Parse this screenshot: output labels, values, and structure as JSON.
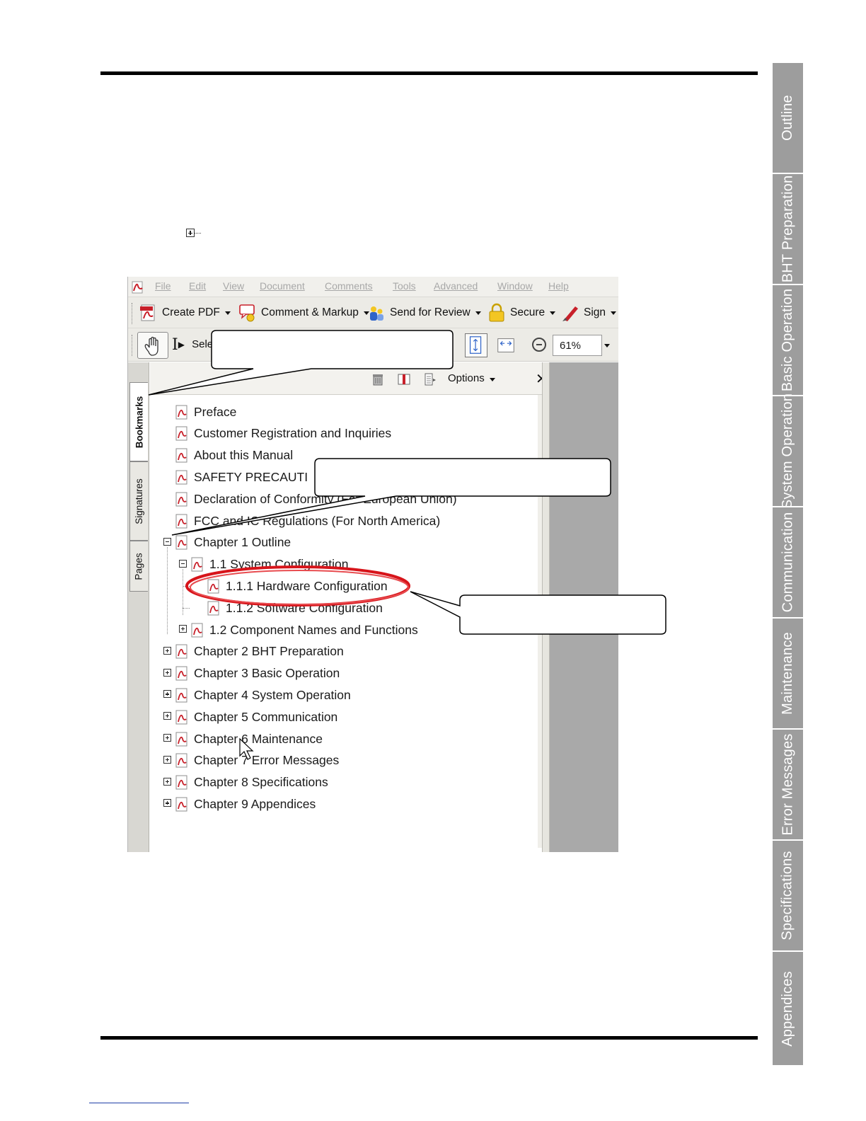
{
  "side_tabs": [
    {
      "label": "Outline",
      "active": false
    },
    {
      "label": "BHT Preparation",
      "active": false
    },
    {
      "label": "Basic Operation",
      "active": false
    },
    {
      "label": "System Operation",
      "active": false
    },
    {
      "label": "Communication",
      "active": false
    },
    {
      "label": "Maintenance",
      "active": false
    },
    {
      "label": "Error Messages",
      "active": false
    },
    {
      "label": "Specifications",
      "active": false
    },
    {
      "label": "Appendices",
      "active": false
    }
  ],
  "reader": {
    "menu": [
      "File",
      "Edit",
      "View",
      "Document",
      "Comments",
      "Tools",
      "Advanced",
      "Window",
      "Help"
    ],
    "toolbar1": {
      "create_pdf": "Create PDF",
      "comment_markup": "Comment & Markup",
      "send_for_review": "Send for Review",
      "secure": "Secure",
      "sign": "Sign"
    },
    "toolbar2": {
      "select": "Sele",
      "zoom": "61%"
    },
    "side_panel_tabs": [
      "Bookmarks",
      "Signatures",
      "Pages"
    ],
    "panel_options": "Options",
    "panel_close": "✕",
    "bookmarks": [
      {
        "label": "Preface",
        "toggle": ""
      },
      {
        "label": "Customer Registration and Inquiries",
        "toggle": ""
      },
      {
        "label": "About this Manual",
        "toggle": ""
      },
      {
        "label": "SAFETY PRECAUTI",
        "toggle": ""
      },
      {
        "label": "Declaration of Conformity (For European Union)",
        "toggle": ""
      },
      {
        "label": "FCC and IC Regulations (For North America)",
        "toggle": ""
      },
      {
        "label": "Chapter 1 Outline",
        "toggle": "minus"
      },
      {
        "label": "1.1 System Configuration",
        "toggle": "minus"
      },
      {
        "label": "1.1.1 Hardware Configuration",
        "toggle": ""
      },
      {
        "label": "1.1.2 Software Configuration",
        "toggle": ""
      },
      {
        "label": "1.2 Component Names and Functions",
        "toggle": "plus"
      },
      {
        "label": "Chapter 2 BHT Preparation",
        "toggle": "plus"
      },
      {
        "label": "Chapter 3 Basic Operation",
        "toggle": "plus"
      },
      {
        "label": "Chapter 4 System Operation",
        "toggle": "plus"
      },
      {
        "label": "Chapter 5 Communication",
        "toggle": "plus"
      },
      {
        "label": "Chapter 6 Maintenance",
        "toggle": "plus"
      },
      {
        "label": "Chapter 7 Error Messages",
        "toggle": "plus"
      },
      {
        "label": "Chapter 8 Specifications",
        "toggle": "plus"
      },
      {
        "label": "Chapter 9 Appendices",
        "toggle": "plus"
      }
    ]
  },
  "colors": {
    "tab_gray": "#9d9d9d",
    "highlight_red": "#d7141a",
    "pdf_icon_red": "#c8202a"
  },
  "icons": {
    "expand": "plus-box-icon",
    "bookmark": "pdf-bookmark-icon",
    "pointer": "arrow-cursor-icon"
  }
}
